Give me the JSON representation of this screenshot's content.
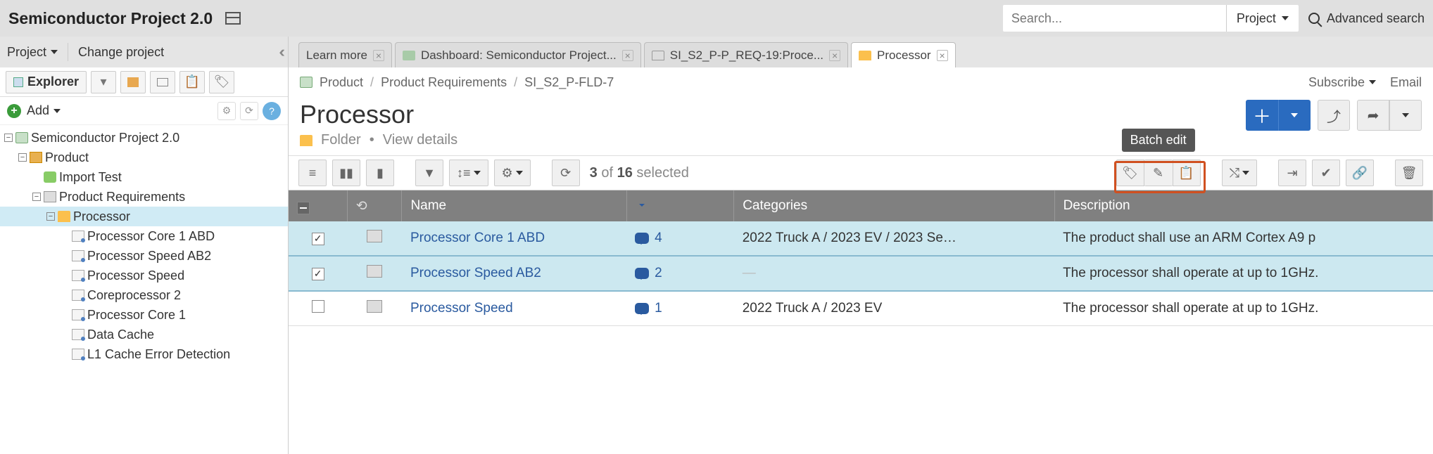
{
  "header": {
    "title": "Semiconductor Project 2.0",
    "search_placeholder": "Search...",
    "scope_label": "Project",
    "advanced_search": "Advanced search"
  },
  "subheader": {
    "project_menu": "Project",
    "change_project": "Change project"
  },
  "tabs": [
    {
      "label": "Learn more",
      "icon": "none",
      "active": false
    },
    {
      "label": "Dashboard: Semiconductor Project...",
      "icon": "dash",
      "active": false
    },
    {
      "label": "SI_S2_P-P_REQ-19:Proce...",
      "icon": "doc",
      "active": false
    },
    {
      "label": "Processor",
      "icon": "folder",
      "active": true
    }
  ],
  "sidebar": {
    "explorer_label": "Explorer",
    "add_label": "Add",
    "tree": {
      "root": "Semiconductor Project 2.0",
      "product": "Product",
      "import_test": "Import Test",
      "prod_req": "Product Requirements",
      "processor": "Processor",
      "leaves": [
        "Processor Core 1 ABD",
        "Processor Speed AB2",
        "Processor Speed",
        "Coreprocessor 2",
        "Processor Core 1",
        "Data Cache",
        "L1 Cache Error Detection"
      ]
    }
  },
  "main": {
    "breadcrumbs": [
      "Product",
      "Product Requirements",
      "SI_S2_P-FLD-7"
    ],
    "subscribe": "Subscribe",
    "email": "Email",
    "title": "Processor",
    "type_label": "Folder",
    "view_details": "View details",
    "selection": {
      "count": "3",
      "of": "of",
      "total": "16",
      "word": "selected"
    },
    "tooltip_batch_edit": "Batch edit",
    "columns": {
      "name": "Name",
      "categories": "Categories",
      "description": "Description"
    },
    "rows": [
      {
        "selected": true,
        "name": "Processor Core 1 ABD",
        "comments": "4",
        "categories": "2022 Truck A / 2023 EV / 2023 Se…",
        "description": "The product shall use an ARM Cortex A9 p"
      },
      {
        "selected": true,
        "name": "Processor Speed AB2",
        "comments": "2",
        "categories": "—",
        "description": "The processor shall operate at up to 1GHz."
      },
      {
        "selected": false,
        "name": "Processor Speed",
        "comments": "1",
        "categories": "2022 Truck A / 2023 EV",
        "description": "The processor shall operate at up to 1GHz."
      }
    ]
  }
}
